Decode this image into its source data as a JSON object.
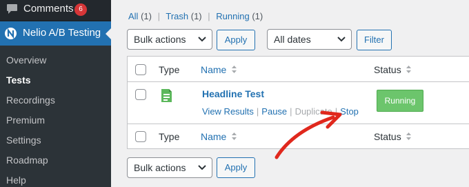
{
  "sidebar": {
    "comments": {
      "label": "Comments",
      "badge": "6",
      "icon": "comment-icon"
    },
    "active": {
      "label": "Nelio A/B Testing",
      "icon": "nelio-logo-icon"
    },
    "items": [
      {
        "label": "Overview"
      },
      {
        "label": "Tests",
        "current": true
      },
      {
        "label": "Recordings"
      },
      {
        "label": "Premium"
      },
      {
        "label": "Settings"
      },
      {
        "label": "Roadmap"
      },
      {
        "label": "Help"
      }
    ]
  },
  "views": {
    "all": "All",
    "all_count": "(1)",
    "trash": "Trash",
    "trash_count": "(1)",
    "running": "Running",
    "running_count": "(1)",
    "separator": "|"
  },
  "toolbar_top": {
    "bulk_actions": "Bulk actions",
    "apply": "Apply",
    "dates": "All dates",
    "filter": "Filter"
  },
  "table": {
    "columns": {
      "type": "Type",
      "name": "Name",
      "status": "Status"
    },
    "rows": [
      {
        "title": "Headline Test",
        "type_icon": "headline-test-icon",
        "actions": {
          "view": "View Results",
          "pause": "Pause",
          "duplicate": "Duplicate",
          "stop": "Stop"
        },
        "status": "Running",
        "status_color": "#6cc56c"
      }
    ]
  },
  "toolbar_bottom": {
    "bulk_actions": "Bulk actions",
    "apply": "Apply"
  },
  "colors": {
    "accent": "#2271b1",
    "annotation_arrow": "#e0281d"
  }
}
